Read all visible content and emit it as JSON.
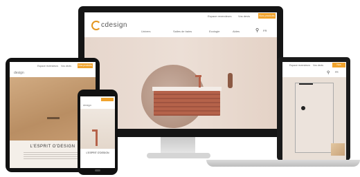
{
  "desktop": {
    "logo": "cdesign",
    "top_links": [
      "Espace revendeurs",
      "Vos devis"
    ],
    "top_cta": "Nos produits",
    "nav": [
      "Univers",
      "Salles de bains",
      "Ecologie",
      "Aides"
    ],
    "lang": "FR"
  },
  "laptop": {
    "top_links": [
      "Espace revendeurs",
      "Vos devis"
    ],
    "top_cta": "Nos produits",
    "lang": "FR"
  },
  "tablet": {
    "top_links": [
      "Espace revendeurs",
      "Vos devis"
    ],
    "top_cta": "Nos produits",
    "logo": "design",
    "headline": "L'ESPRIT O'DESIGN"
  },
  "phone": {
    "logo": "design",
    "caption": "L'ESPRIT O'DESIGN"
  },
  "colors": {
    "accent": "#f0a32d",
    "copper": "#b5624a"
  },
  "icons": {
    "search": "search-icon"
  }
}
